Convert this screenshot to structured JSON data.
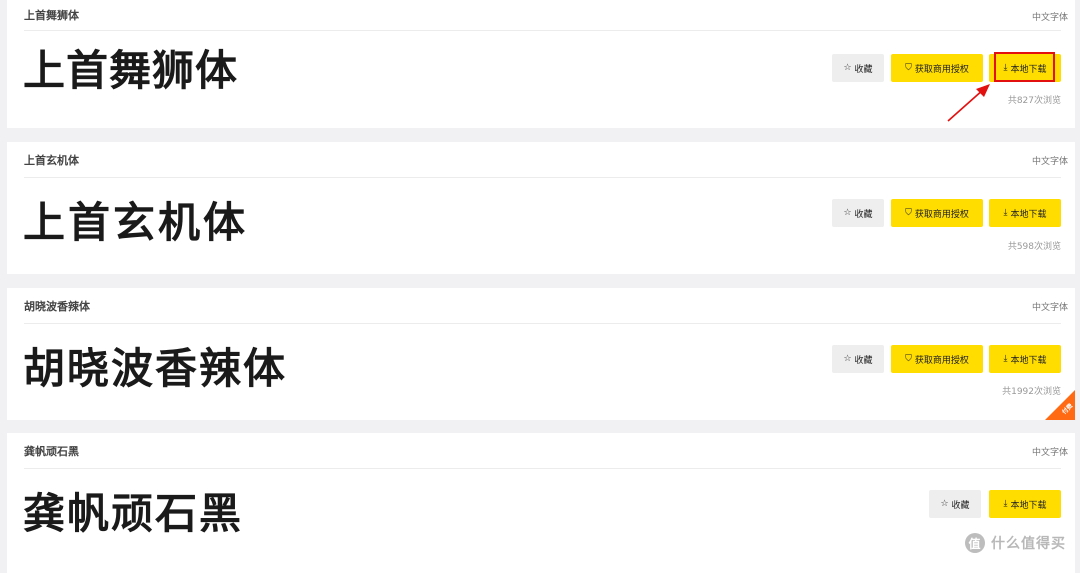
{
  "cards": [
    {
      "title": "上首舞狮体",
      "category": "中文字体",
      "sample": "上首舞狮体",
      "fav_label": "收藏",
      "license_label": "获取商用授权",
      "download_label": "本地下载",
      "views": "共827次浏览"
    },
    {
      "title": "上首玄机体",
      "category": "中文字体",
      "sample": "上首玄机体",
      "fav_label": "收藏",
      "license_label": "获取商用授权",
      "download_label": "本地下载",
      "views": "共598次浏览"
    },
    {
      "title": "胡晓波香辣体",
      "category": "中文字体",
      "sample": "胡晓波香辣体",
      "fav_label": "收藏",
      "license_label": "获取商用授权",
      "download_label": "本地下载",
      "views": "共1992次浏览",
      "badge": "付费"
    },
    {
      "title": "龚帆顽石黑",
      "category": "中文字体",
      "sample": "龚帆顽石黑",
      "fav_label": "收藏",
      "download_label": "本地下载"
    }
  ],
  "icons": {
    "star": "☆",
    "shield": "⛉",
    "download": "⤓"
  },
  "colors": {
    "accent_yellow": "#ffdd00",
    "highlight_red": "#e31010",
    "badge_orange": "#ff6a13"
  },
  "watermark": {
    "logo": "值",
    "text": "什么值得买"
  }
}
